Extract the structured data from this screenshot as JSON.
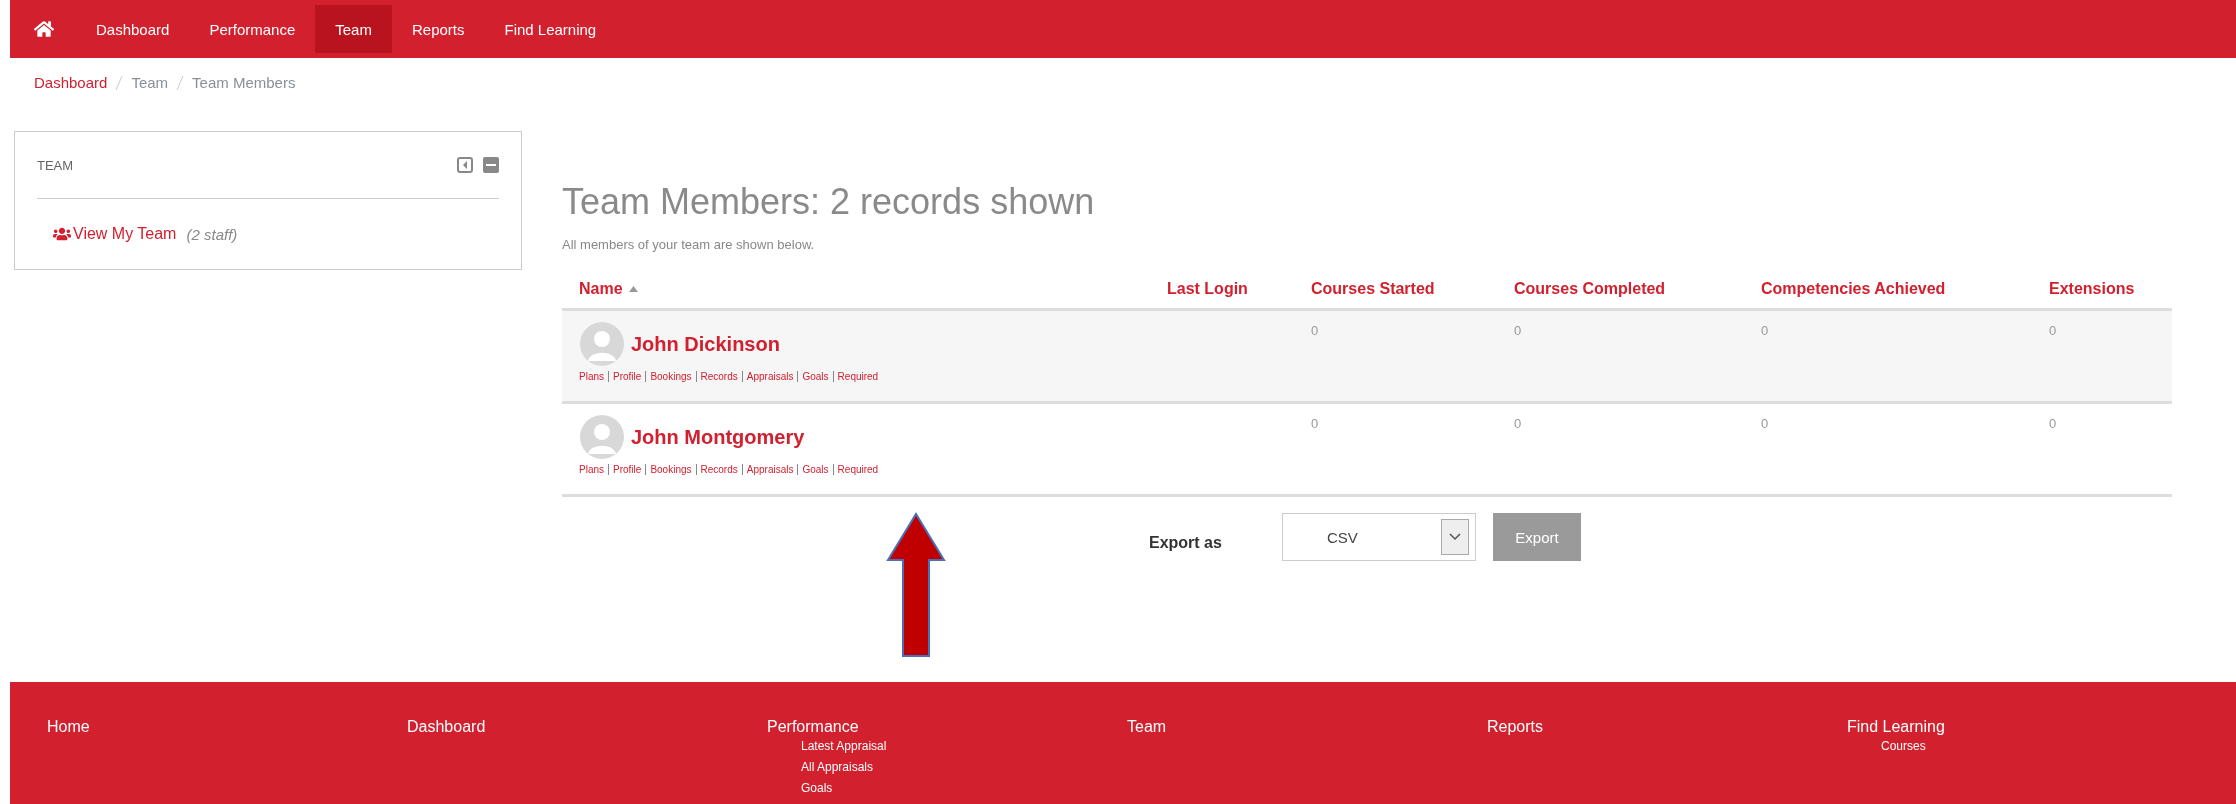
{
  "nav": {
    "items": [
      {
        "label": "Dashboard",
        "selected": false
      },
      {
        "label": "Performance",
        "selected": false
      },
      {
        "label": "Team",
        "selected": true
      },
      {
        "label": "Reports",
        "selected": false
      },
      {
        "label": "Find Learning",
        "selected": false
      }
    ]
  },
  "breadcrumb": [
    {
      "label": "Dashboard",
      "kind": "link"
    },
    {
      "label": "Team",
      "kind": "text"
    },
    {
      "label": "Team Members",
      "kind": "text"
    }
  ],
  "sidebar_block": {
    "title": "TEAM",
    "link": "View My Team",
    "note": "(2 staff)"
  },
  "heading": "Team Members: 2 records shown",
  "intro": "All members of your team are shown below.",
  "table": {
    "columns": [
      {
        "label": "Name",
        "sorted": true
      },
      {
        "label": "Last Login",
        "sorted": false
      },
      {
        "label": "Courses Started",
        "sorted": false
      },
      {
        "label": "Courses Completed",
        "sorted": false
      },
      {
        "label": "Competencies Achieved",
        "sorted": false
      },
      {
        "label": "Extensions",
        "sorted": false
      }
    ],
    "rows": [
      {
        "name": "John Dickinson",
        "links": [
          "Plans",
          "Profile",
          "Bookings",
          "Records",
          "Appraisals",
          "Goals",
          "Required"
        ],
        "values": [
          "0",
          "0",
          "0",
          "0"
        ]
      },
      {
        "name": "John Montgomery",
        "links": [
          "Plans",
          "Profile",
          "Bookings",
          "Records",
          "Appraisals",
          "Goals",
          "Required"
        ],
        "values": [
          "0",
          "0",
          "0",
          "0"
        ]
      }
    ]
  },
  "export": {
    "label": "Export as",
    "format": "CSV",
    "button": "Export"
  },
  "footer": [
    {
      "label": "Home"
    },
    {
      "label": "Dashboard"
    },
    {
      "label": "Performance",
      "children": [
        "Latest Appraisal",
        "All Appraisals",
        "Goals"
      ]
    },
    {
      "label": "Team"
    },
    {
      "label": "Reports"
    },
    {
      "label": "Find Learning",
      "children": [
        "Courses"
      ]
    }
  ]
}
